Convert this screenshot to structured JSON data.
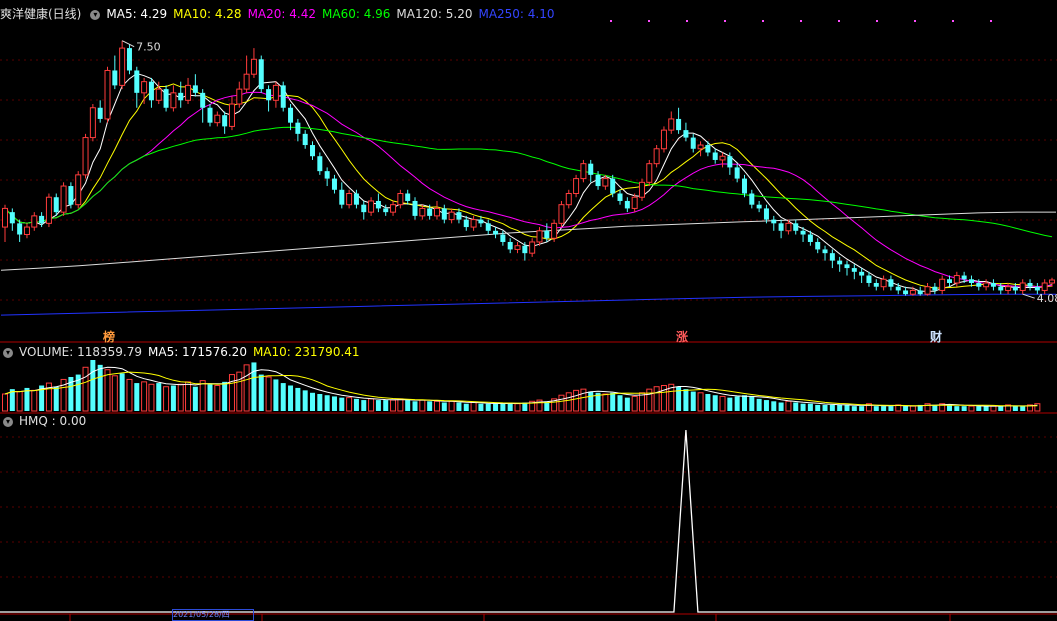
{
  "colors": {
    "up": "#ff3c3c",
    "down": "#54ffff",
    "ma5": "#ffffff",
    "ma10": "#ffff00",
    "ma20": "#ff00ff",
    "ma60": "#00ff00",
    "ma120": "#dddddd",
    "ma250": "#2233ff",
    "grid": "#5a0000",
    "hmq": "#ffffff"
  },
  "header": {
    "stock_name": "爽洋健康(日线)",
    "ma5_label": "MA5: 4.29",
    "ma10_label": "MA10: 4.28",
    "ma20_label": "MA20: 4.42",
    "ma60_label": "MA60: 4.96",
    "ma120_label": "MA120: 5.20",
    "ma250_label": "MA250: 4.10"
  },
  "markers": [
    {
      "text": "榜",
      "color": "#ff9a3c"
    },
    {
      "text": "涨",
      "color": "#ff5a5a"
    },
    {
      "text": "财",
      "color": "#cfe3ff"
    }
  ],
  "volume_header": {
    "volume_label": "VOLUME: 118359.79",
    "ma5_label": "MA5: 171576.20",
    "ma10_label": "MA10: 231790.41"
  },
  "hmq_header": {
    "label": "HMQ : 0.00"
  },
  "axis": {
    "date_box": "2021/05/28/四"
  },
  "chart_data": {
    "type": "candlestick",
    "y_range": [
      3.7,
      7.75
    ],
    "annotations": [
      {
        "text": "7.50",
        "index": 16
      },
      {
        "text": "4.08",
        "index": 139
      }
    ],
    "candles": [
      [
        5.0,
        5.25,
        5.3,
        4.8
      ],
      [
        5.2,
        5.05,
        5.25,
        4.95
      ],
      [
        5.05,
        4.9,
        5.1,
        4.8
      ],
      [
        4.9,
        5.0,
        5.05,
        4.85
      ],
      [
        5.0,
        5.15,
        5.2,
        4.95
      ],
      [
        5.15,
        5.05,
        5.2,
        5.0
      ],
      [
        5.05,
        5.4,
        5.45,
        5.0
      ],
      [
        5.4,
        5.2,
        5.45,
        5.15
      ],
      [
        5.2,
        5.55,
        5.6,
        5.15
      ],
      [
        5.55,
        5.3,
        5.6,
        5.25
      ],
      [
        5.3,
        5.7,
        5.75,
        5.25
      ],
      [
        5.7,
        6.2,
        6.25,
        5.65
      ],
      [
        6.2,
        6.6,
        6.65,
        6.15
      ],
      [
        6.6,
        6.45,
        6.7,
        6.4
      ],
      [
        6.45,
        7.1,
        7.15,
        6.4
      ],
      [
        7.1,
        6.9,
        7.3,
        6.85
      ],
      [
        6.9,
        7.4,
        7.5,
        6.85
      ],
      [
        7.4,
        7.1,
        7.45,
        7.05
      ],
      [
        7.1,
        6.8,
        7.15,
        6.6
      ],
      [
        6.8,
        6.95,
        7.0,
        6.65
      ],
      [
        6.95,
        6.7,
        7.0,
        6.6
      ],
      [
        6.7,
        6.85,
        6.95,
        6.65
      ],
      [
        6.85,
        6.6,
        6.9,
        6.55
      ],
      [
        6.6,
        6.8,
        6.9,
        6.55
      ],
      [
        6.8,
        6.7,
        6.95,
        6.6
      ],
      [
        6.7,
        6.9,
        7.0,
        6.65
      ],
      [
        6.9,
        6.8,
        7.05,
        6.75
      ],
      [
        6.8,
        6.6,
        6.85,
        6.4
      ],
      [
        6.6,
        6.4,
        6.65,
        6.35
      ],
      [
        6.4,
        6.5,
        6.55,
        6.35
      ],
      [
        6.5,
        6.35,
        6.55,
        6.25
      ],
      [
        6.35,
        6.65,
        6.75,
        6.3
      ],
      [
        6.65,
        6.85,
        6.95,
        6.6
      ],
      [
        6.85,
        7.05,
        7.3,
        6.8
      ],
      [
        7.05,
        7.25,
        7.4,
        7.0
      ],
      [
        7.25,
        6.85,
        7.3,
        6.8
      ],
      [
        6.85,
        6.7,
        6.9,
        6.55
      ],
      [
        6.7,
        6.9,
        6.95,
        6.6
      ],
      [
        6.9,
        6.6,
        6.95,
        6.55
      ],
      [
        6.6,
        6.4,
        6.65,
        6.3
      ],
      [
        6.4,
        6.25,
        6.45,
        6.15
      ],
      [
        6.25,
        6.1,
        6.3,
        6.05
      ],
      [
        6.1,
        5.95,
        6.15,
        5.9
      ],
      [
        5.95,
        5.75,
        6.0,
        5.7
      ],
      [
        5.75,
        5.65,
        5.8,
        5.55
      ],
      [
        5.65,
        5.5,
        5.7,
        5.45
      ],
      [
        5.5,
        5.3,
        5.6,
        5.25
      ],
      [
        5.3,
        5.45,
        5.5,
        5.25
      ],
      [
        5.45,
        5.3,
        5.5,
        5.25
      ],
      [
        5.3,
        5.2,
        5.35,
        5.1
      ],
      [
        5.2,
        5.35,
        5.4,
        5.15
      ],
      [
        5.35,
        5.25,
        5.45,
        5.2
      ],
      [
        5.25,
        5.2,
        5.3,
        5.15
      ],
      [
        5.2,
        5.3,
        5.35,
        5.15
      ],
      [
        5.3,
        5.45,
        5.5,
        5.25
      ],
      [
        5.45,
        5.35,
        5.5,
        5.3
      ],
      [
        5.35,
        5.15,
        5.4,
        5.1
      ],
      [
        5.15,
        5.25,
        5.3,
        5.1
      ],
      [
        5.25,
        5.15,
        5.3,
        5.1
      ],
      [
        5.15,
        5.25,
        5.35,
        5.1
      ],
      [
        5.25,
        5.1,
        5.3,
        5.05
      ],
      [
        5.1,
        5.2,
        5.25,
        5.05
      ],
      [
        5.2,
        5.1,
        5.25,
        5.05
      ],
      [
        5.1,
        5.0,
        5.15,
        4.95
      ],
      [
        5.0,
        5.1,
        5.15,
        4.95
      ],
      [
        5.1,
        5.05,
        5.15,
        5.0
      ],
      [
        5.05,
        4.95,
        5.1,
        4.9
      ],
      [
        4.95,
        4.9,
        5.0,
        4.85
      ],
      [
        4.9,
        4.8,
        4.95,
        4.75
      ],
      [
        4.8,
        4.7,
        4.85,
        4.65
      ],
      [
        4.7,
        4.75,
        4.8,
        4.65
      ],
      [
        4.75,
        4.65,
        4.8,
        4.55
      ],
      [
        4.65,
        4.8,
        4.85,
        4.6
      ],
      [
        4.8,
        4.95,
        5.0,
        4.75
      ],
      [
        4.95,
        4.85,
        5.05,
        4.8
      ],
      [
        4.85,
        5.05,
        5.1,
        4.8
      ],
      [
        5.05,
        5.3,
        5.35,
        5.0
      ],
      [
        5.3,
        5.45,
        5.5,
        5.25
      ],
      [
        5.45,
        5.65,
        5.7,
        5.4
      ],
      [
        5.65,
        5.85,
        5.9,
        5.6
      ],
      [
        5.85,
        5.7,
        5.9,
        5.6
      ],
      [
        5.7,
        5.55,
        5.75,
        5.5
      ],
      [
        5.55,
        5.65,
        5.7,
        5.5
      ],
      [
        5.65,
        5.45,
        5.7,
        5.4
      ],
      [
        5.45,
        5.35,
        5.5,
        5.3
      ],
      [
        5.35,
        5.25,
        5.4,
        5.2
      ],
      [
        5.25,
        5.4,
        5.45,
        5.2
      ],
      [
        5.4,
        5.6,
        5.65,
        5.35
      ],
      [
        5.6,
        5.85,
        5.9,
        5.55
      ],
      [
        5.85,
        6.05,
        6.1,
        5.8
      ],
      [
        6.05,
        6.3,
        6.35,
        6.0
      ],
      [
        6.3,
        6.45,
        6.55,
        6.25
      ],
      [
        6.45,
        6.3,
        6.6,
        6.25
      ],
      [
        6.3,
        6.2,
        6.4,
        6.15
      ],
      [
        6.2,
        6.05,
        6.25,
        6.0
      ],
      [
        6.05,
        6.1,
        6.15,
        5.95
      ],
      [
        6.1,
        6.0,
        6.15,
        5.95
      ],
      [
        6.0,
        5.9,
        6.05,
        5.85
      ],
      [
        5.9,
        5.95,
        6.0,
        5.8
      ],
      [
        5.95,
        5.8,
        6.0,
        5.7
      ],
      [
        5.8,
        5.65,
        5.85,
        5.6
      ],
      [
        5.65,
        5.45,
        5.7,
        5.4
      ],
      [
        5.45,
        5.3,
        5.5,
        5.25
      ],
      [
        5.3,
        5.25,
        5.35,
        5.2
      ],
      [
        5.25,
        5.1,
        5.3,
        5.05
      ],
      [
        5.1,
        5.05,
        5.15,
        4.95
      ],
      [
        5.05,
        4.95,
        5.1,
        4.85
      ],
      [
        4.95,
        5.05,
        5.1,
        4.9
      ],
      [
        5.05,
        4.95,
        5.1,
        4.9
      ],
      [
        4.95,
        4.9,
        5.0,
        4.8
      ],
      [
        4.9,
        4.8,
        4.95,
        4.75
      ],
      [
        4.8,
        4.7,
        4.85,
        4.65
      ],
      [
        4.7,
        4.65,
        4.75,
        4.55
      ],
      [
        4.65,
        4.55,
        4.7,
        4.45
      ],
      [
        4.55,
        4.5,
        4.6,
        4.4
      ],
      [
        4.5,
        4.45,
        4.55,
        4.35
      ],
      [
        4.45,
        4.4,
        4.5,
        4.3
      ],
      [
        4.4,
        4.35,
        4.45,
        4.25
      ],
      [
        4.35,
        4.25,
        4.4,
        4.2
      ],
      [
        4.25,
        4.2,
        4.3,
        4.15
      ],
      [
        4.2,
        4.3,
        4.35,
        4.15
      ],
      [
        4.3,
        4.2,
        4.35,
        4.15
      ],
      [
        4.2,
        4.15,
        4.25,
        4.1
      ],
      [
        4.15,
        4.1,
        4.2,
        4.08
      ],
      [
        4.1,
        4.15,
        4.2,
        4.08
      ],
      [
        4.15,
        4.1,
        4.2,
        4.08
      ],
      [
        4.1,
        4.2,
        4.25,
        4.08
      ],
      [
        4.2,
        4.15,
        4.25,
        4.1
      ],
      [
        4.15,
        4.3,
        4.35,
        4.1
      ],
      [
        4.3,
        4.25,
        4.35,
        4.2
      ],
      [
        4.25,
        4.35,
        4.4,
        4.2
      ],
      [
        4.35,
        4.3,
        4.4,
        4.25
      ],
      [
        4.3,
        4.25,
        4.35,
        4.2
      ],
      [
        4.25,
        4.2,
        4.3,
        4.15
      ],
      [
        4.2,
        4.25,
        4.3,
        4.15
      ],
      [
        4.25,
        4.2,
        4.3,
        4.15
      ],
      [
        4.2,
        4.15,
        4.25,
        4.1
      ],
      [
        4.15,
        4.2,
        4.25,
        4.1
      ],
      [
        4.2,
        4.15,
        4.25,
        4.1
      ],
      [
        4.15,
        4.25,
        4.3,
        4.1
      ],
      [
        4.25,
        4.2,
        4.3,
        4.15
      ],
      [
        4.2,
        4.15,
        4.25,
        4.1
      ],
      [
        4.15,
        4.25,
        4.3,
        4.1
      ],
      [
        4.25,
        4.29,
        4.32,
        4.2
      ]
    ],
    "ma120": [
      4.42,
      4.45,
      4.48,
      4.52,
      4.56,
      4.6,
      4.64,
      4.68,
      4.72,
      4.76,
      4.8,
      4.84,
      4.88,
      4.92,
      4.95,
      4.98,
      5.01,
      5.03,
      5.05,
      5.07,
      5.09,
      5.11,
      5.13,
      5.15,
      5.17,
      5.19,
      5.2,
      5.2
    ],
    "ma250": [
      3.82,
      3.84,
      3.86,
      3.88,
      3.9,
      3.92,
      3.94,
      3.96,
      3.98,
      4.0,
      4.02,
      4.04,
      4.06,
      4.07,
      4.08,
      4.09,
      4.1,
      4.1
    ],
    "volume": [
      [
        140,
        0
      ],
      [
        180,
        1
      ],
      [
        160,
        0
      ],
      [
        190,
        1
      ],
      [
        170,
        0
      ],
      [
        210,
        1
      ],
      [
        230,
        0
      ],
      [
        200,
        1
      ],
      [
        260,
        0
      ],
      [
        280,
        1
      ],
      [
        300,
        1
      ],
      [
        360,
        0
      ],
      [
        420,
        1
      ],
      [
        380,
        1
      ],
      [
        340,
        0
      ],
      [
        290,
        0
      ],
      [
        310,
        1
      ],
      [
        260,
        0
      ],
      [
        230,
        1
      ],
      [
        240,
        0
      ],
      [
        220,
        0
      ],
      [
        230,
        1
      ],
      [
        200,
        0
      ],
      [
        210,
        1
      ],
      [
        220,
        0
      ],
      [
        240,
        0
      ],
      [
        200,
        1
      ],
      [
        250,
        0
      ],
      [
        220,
        1
      ],
      [
        210,
        0
      ],
      [
        240,
        1
      ],
      [
        300,
        0
      ],
      [
        320,
        0
      ],
      [
        380,
        0
      ],
      [
        400,
        1
      ],
      [
        300,
        1
      ],
      [
        280,
        0
      ],
      [
        260,
        1
      ],
      [
        230,
        1
      ],
      [
        210,
        1
      ],
      [
        190,
        1
      ],
      [
        170,
        1
      ],
      [
        150,
        1
      ],
      [
        140,
        1
      ],
      [
        130,
        1
      ],
      [
        120,
        1
      ],
      [
        110,
        1
      ],
      [
        110,
        0
      ],
      [
        100,
        1
      ],
      [
        90,
        1
      ],
      [
        100,
        0
      ],
      [
        90,
        1
      ],
      [
        90,
        1
      ],
      [
        90,
        0
      ],
      [
        100,
        0
      ],
      [
        90,
        1
      ],
      [
        80,
        1
      ],
      [
        90,
        0
      ],
      [
        80,
        1
      ],
      [
        80,
        0
      ],
      [
        70,
        1
      ],
      [
        80,
        0
      ],
      [
        70,
        1
      ],
      [
        60,
        1
      ],
      [
        70,
        0
      ],
      [
        60,
        1
      ],
      [
        60,
        1
      ],
      [
        60,
        1
      ],
      [
        60,
        1
      ],
      [
        70,
        1
      ],
      [
        60,
        0
      ],
      [
        70,
        1
      ],
      [
        80,
        0
      ],
      [
        90,
        0
      ],
      [
        80,
        1
      ],
      [
        100,
        0
      ],
      [
        130,
        0
      ],
      [
        150,
        0
      ],
      [
        170,
        0
      ],
      [
        180,
        0
      ],
      [
        160,
        1
      ],
      [
        150,
        1
      ],
      [
        140,
        0
      ],
      [
        150,
        1
      ],
      [
        130,
        1
      ],
      [
        110,
        1
      ],
      [
        120,
        0
      ],
      [
        150,
        0
      ],
      [
        180,
        0
      ],
      [
        200,
        0
      ],
      [
        210,
        0
      ],
      [
        220,
        0
      ],
      [
        200,
        1
      ],
      [
        180,
        1
      ],
      [
        160,
        1
      ],
      [
        150,
        0
      ],
      [
        140,
        1
      ],
      [
        130,
        1
      ],
      [
        120,
        0
      ],
      [
        110,
        1
      ],
      [
        120,
        1
      ],
      [
        130,
        1
      ],
      [
        120,
        1
      ],
      [
        100,
        1
      ],
      [
        90,
        1
      ],
      [
        80,
        1
      ],
      [
        70,
        1
      ],
      [
        80,
        0
      ],
      [
        70,
        1
      ],
      [
        60,
        1
      ],
      [
        60,
        1
      ],
      [
        50,
        1
      ],
      [
        50,
        1
      ],
      [
        50,
        1
      ],
      [
        50,
        1
      ],
      [
        50,
        1
      ],
      [
        40,
        1
      ],
      [
        40,
        1
      ],
      [
        60,
        0
      ],
      [
        40,
        1
      ],
      [
        40,
        1
      ],
      [
        40,
        1
      ],
      [
        50,
        0
      ],
      [
        40,
        1
      ],
      [
        40,
        0
      ],
      [
        50,
        1
      ],
      [
        60,
        0
      ],
      [
        50,
        1
      ],
      [
        60,
        0
      ],
      [
        50,
        1
      ],
      [
        40,
        1
      ],
      [
        40,
        1
      ],
      [
        40,
        0
      ],
      [
        40,
        1
      ],
      [
        40,
        1
      ],
      [
        40,
        0
      ],
      [
        40,
        1
      ],
      [
        50,
        0
      ],
      [
        40,
        1
      ],
      [
        40,
        1
      ],
      [
        50,
        0
      ],
      [
        60,
        0
      ]
    ],
    "hmq": {
      "peak_index": 93,
      "peak_value": 1,
      "base_value": 0,
      "y_range": [
        0,
        1
      ]
    }
  }
}
